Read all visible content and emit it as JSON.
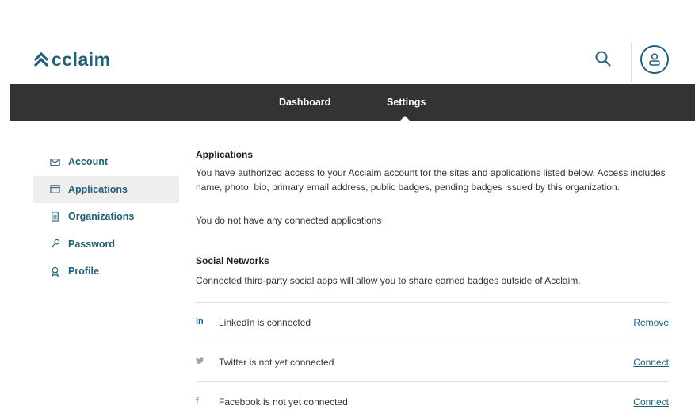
{
  "header": {
    "logo_text": "cclaim",
    "brand_color": "#245f78",
    "search_icon": "search-icon",
    "avatar_icon": "user-icon"
  },
  "nav": {
    "items": [
      {
        "label": "Dashboard"
      },
      {
        "label": "Settings"
      }
    ],
    "active": "Settings",
    "bar_color": "#333333"
  },
  "sidebar": {
    "items": [
      {
        "label": "Account",
        "icon": "envelope-icon"
      },
      {
        "label": "Applications",
        "icon": "window-icon"
      },
      {
        "label": "Organizations",
        "icon": "building-icon"
      },
      {
        "label": "Password",
        "icon": "key-icon"
      },
      {
        "label": "Profile",
        "icon": "badge-icon"
      }
    ],
    "active": "Applications"
  },
  "applications": {
    "title": "Applications",
    "description": "You have authorized access to your Acclaim account for the sites and applications listed below. Access includes name, photo, bio, primary email address, public badges, pending badges issued by this organization.",
    "empty_text": "You do not have any connected applications"
  },
  "social": {
    "title": "Social Networks",
    "description": "Connected third-party social apps will allow you to share earned badges outside of Acclaim.",
    "networks": [
      {
        "icon": "in",
        "icon_name": "linkedin-icon",
        "text": "LinkedIn is connected",
        "action": "Remove"
      },
      {
        "icon": "🐦",
        "icon_name": "twitter-icon",
        "text": "Twitter is not yet connected",
        "action": "Connect"
      },
      {
        "icon": "f",
        "icon_name": "facebook-icon",
        "text": "Facebook is not yet connected",
        "action": "Connect"
      }
    ]
  }
}
